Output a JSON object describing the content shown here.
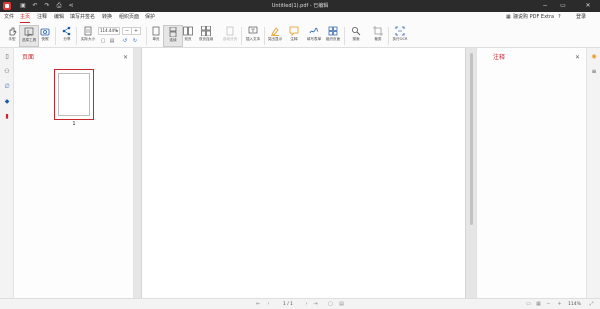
{
  "window": {
    "title": "Untitled(1).pdf - 已编辑",
    "minimize_icon": "minimize-icon",
    "maximize_icon": "maximize-icon",
    "close_icon": "close-icon"
  },
  "menu": {
    "items": [
      "文件",
      "主页",
      "注释",
      "编辑",
      "填写并签名",
      "转换",
      "组织页面",
      "保护"
    ],
    "active": "主页",
    "right": {
      "upgrade": "骊说购 PDF Extra",
      "login": "登录"
    }
  },
  "ribbon": {
    "hand": "手型",
    "select": "选择工具",
    "snapshot": "快照",
    "share": "分享",
    "page_size": "实际大小",
    "zoom_value": "114.44%",
    "zoom_minus": "−",
    "zoom_plus": "+",
    "single_page": "单页",
    "continuous": "连续",
    "two_page": "双页",
    "two_page_cont": "双页连续",
    "auto_scroll": "自动分页",
    "add_text": "插入文本",
    "highlight": "突出显示",
    "note": "注释",
    "sign": "填写表单",
    "organize": "组织页面",
    "search": "搜索",
    "crop": "裁剪",
    "ocr": "执行OCR"
  },
  "thumbnails": {
    "title": "页面",
    "page_numbers": [
      "1"
    ]
  },
  "comments": {
    "title": "注释"
  },
  "status": {
    "page_indicator": "1 / 1",
    "zoom_label": "114%"
  },
  "colors": {
    "accent": "#c9252c",
    "titlebar": "#2b2b2b"
  }
}
